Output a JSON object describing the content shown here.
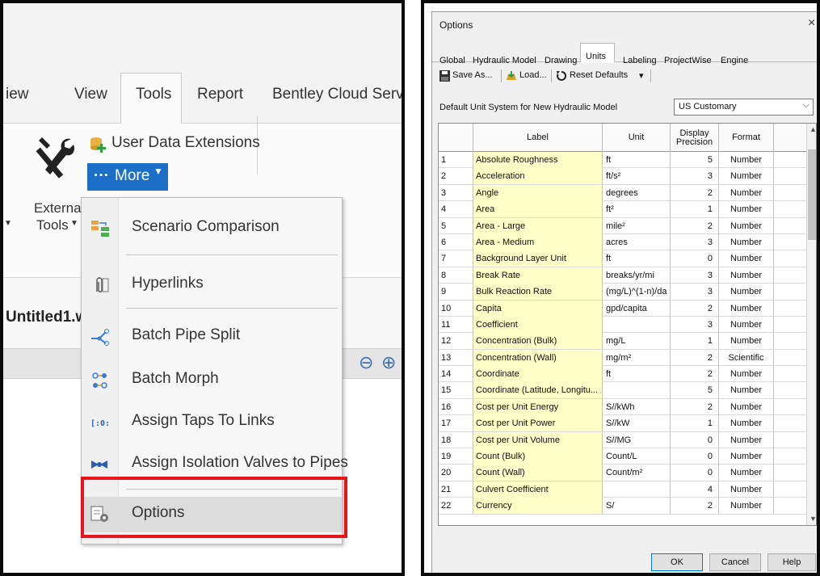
{
  "left_panel": {
    "ribbon_tabs": [
      "iew",
      "View",
      "Tools",
      "Report",
      "Bentley Cloud Servic"
    ],
    "external_tools": {
      "line1": "External",
      "line2": "Tools"
    },
    "user_data_extensions": "User Data Extensions",
    "more_button": {
      "dots": "···",
      "label": "More",
      "caret": "▼"
    },
    "menu_items": [
      {
        "label": "Scenario Comparison",
        "icon": "scenario-comparison-icon"
      },
      {
        "label": "Hyperlinks",
        "icon": "paperclip-icon"
      },
      {
        "label": "Batch Pipe Split",
        "icon": "pipe-split-icon"
      },
      {
        "label": "Batch Morph",
        "icon": "batch-morph-icon"
      },
      {
        "label": "Assign Taps To Links",
        "icon": "taps-links-icon"
      },
      {
        "label": "Assign Isolation Valves to Pipes",
        "icon": "isolation-valve-icon"
      },
      {
        "label": "Options",
        "icon": "options-gear-icon"
      }
    ],
    "document_title": "Untitled1.w",
    "highlight_color": "#e8141b",
    "accent_color": "#1b6fc6"
  },
  "dialog": {
    "title": "Options",
    "close": "×",
    "tabs": [
      "Global",
      "Hydraulic Model",
      "Drawing",
      "Units",
      "Labeling",
      "ProjectWise",
      "Engine"
    ],
    "active_tab": "Units",
    "toolbar": {
      "save_as": "Save As...",
      "load": "Load...",
      "reset_defaults": "Reset Defaults",
      "reset_caret": "▾"
    },
    "default_unit_label": "Default Unit System for New Hydraulic Model",
    "default_unit_value": "US Customary",
    "columns": {
      "label": "Label",
      "unit": "Unit",
      "precision_line1": "Display",
      "precision_line2": "Precision",
      "format": "Format"
    },
    "rows": [
      {
        "n": "1",
        "label": "Absolute Roughness",
        "unit": "ft",
        "prec": "5",
        "fmt": "Number"
      },
      {
        "n": "2",
        "label": "Acceleration",
        "unit": "ft/s²",
        "prec": "3",
        "fmt": "Number"
      },
      {
        "n": "3",
        "label": "Angle",
        "unit": "degrees",
        "prec": "2",
        "fmt": "Number"
      },
      {
        "n": "4",
        "label": "Area",
        "unit": "ft²",
        "prec": "1",
        "fmt": "Number"
      },
      {
        "n": "5",
        "label": "Area - Large",
        "unit": "mile²",
        "prec": "2",
        "fmt": "Number"
      },
      {
        "n": "6",
        "label": "Area - Medium",
        "unit": "acres",
        "prec": "3",
        "fmt": "Number"
      },
      {
        "n": "7",
        "label": "Background Layer Unit",
        "unit": "ft",
        "prec": "0",
        "fmt": "Number"
      },
      {
        "n": "8",
        "label": "Break Rate",
        "unit": "breaks/yr/mi",
        "prec": "3",
        "fmt": "Number"
      },
      {
        "n": "9",
        "label": "Bulk Reaction Rate",
        "unit": "(mg/L)^(1-n)/da",
        "prec": "3",
        "fmt": "Number"
      },
      {
        "n": "10",
        "label": "Capita",
        "unit": "gpd/capita",
        "prec": "2",
        "fmt": "Number"
      },
      {
        "n": "11",
        "label": "Coefficient",
        "unit": "",
        "prec": "3",
        "fmt": "Number"
      },
      {
        "n": "12",
        "label": "Concentration (Bulk)",
        "unit": "mg/L",
        "prec": "1",
        "fmt": "Number"
      },
      {
        "n": "13",
        "label": "Concentration (Wall)",
        "unit": "mg/m²",
        "prec": "2",
        "fmt": "Scientific"
      },
      {
        "n": "14",
        "label": "Coordinate",
        "unit": "ft",
        "prec": "2",
        "fmt": "Number"
      },
      {
        "n": "15",
        "label": "Coordinate (Latitude, Longitu...",
        "unit": "",
        "prec": "5",
        "fmt": "Number"
      },
      {
        "n": "16",
        "label": "Cost per Unit Energy",
        "unit": "S//kWh",
        "prec": "2",
        "fmt": "Number"
      },
      {
        "n": "17",
        "label": "Cost per Unit Power",
        "unit": "S//kW",
        "prec": "1",
        "fmt": "Number"
      },
      {
        "n": "18",
        "label": "Cost per Unit Volume",
        "unit": "S//MG",
        "prec": "0",
        "fmt": "Number"
      },
      {
        "n": "19",
        "label": "Count (Bulk)",
        "unit": "Count/L",
        "prec": "0",
        "fmt": "Number"
      },
      {
        "n": "20",
        "label": "Count (Wall)",
        "unit": "Count/m²",
        "prec": "0",
        "fmt": "Number"
      },
      {
        "n": "21",
        "label": "Culvert Coefficient",
        "unit": "",
        "prec": "4",
        "fmt": "Number"
      },
      {
        "n": "22",
        "label": "Currency",
        "unit": "S/",
        "prec": "2",
        "fmt": "Number"
      }
    ],
    "buttons": {
      "ok": "OK",
      "cancel": "Cancel",
      "help": "Help"
    },
    "label_cell_color": "#ffffc8"
  }
}
